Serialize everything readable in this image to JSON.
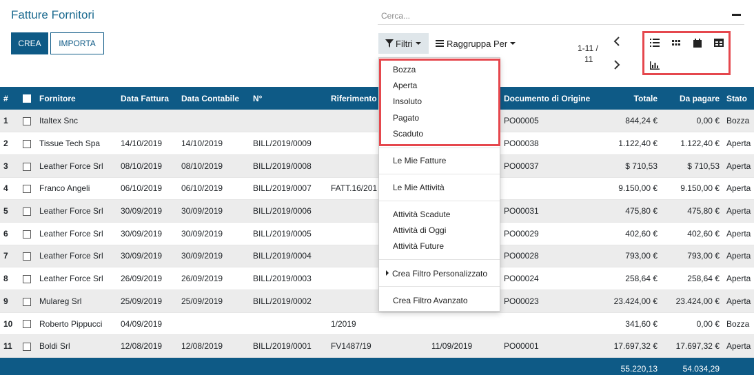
{
  "page_title": "Fatture Fornitori",
  "buttons": {
    "crea": "CREA",
    "importa": "IMPORTA"
  },
  "search": {
    "placeholder": "Cerca...",
    "value": ""
  },
  "toolbar": {
    "filtri": "Filtri",
    "raggruppa": "Raggruppa Per"
  },
  "pager": {
    "range": "1-11 /",
    "total": "11"
  },
  "views": [
    "list-view-icon",
    "kanban-view-icon",
    "calendar-view-icon",
    "pivot-view-icon",
    "graph-view-icon"
  ],
  "filters_menu": {
    "status_filters": [
      "Bozza",
      "Aperta",
      "Insoluto",
      "Pagato",
      "Scaduto"
    ],
    "my_invoices": "Le Mie Fatture",
    "my_activities": "Le Mie Attività",
    "activity_filters": [
      "Attività Scadute",
      "Attività di Oggi",
      "Attività Future"
    ],
    "custom_filter": "Crea Filtro Personalizzato",
    "advanced_filter": "Crea Filtro Avanzato"
  },
  "table": {
    "columns": [
      "#",
      "",
      "Fornitore",
      "Data Fattura",
      "Data Contabile",
      "N°",
      "Riferimento",
      "",
      "Documento di Origine",
      "Totale",
      "Da pagare",
      "Stato"
    ],
    "rows": [
      [
        "1",
        "",
        "Italtex Snc",
        "",
        "",
        "",
        "",
        "",
        "PO00005",
        "844,24 €",
        "0,00 €",
        "Bozza"
      ],
      [
        "2",
        "",
        "Tissue Tech Spa",
        "14/10/2019",
        "14/10/2019",
        "BILL/2019/0009",
        "",
        "",
        "PO00038",
        "1.122,40 €",
        "1.122,40 €",
        "Aperta"
      ],
      [
        "3",
        "",
        "Leather Force Srl",
        "08/10/2019",
        "08/10/2019",
        "BILL/2019/0008",
        "",
        "",
        "PO00037",
        "$ 710,53",
        "$ 710,53",
        "Aperta"
      ],
      [
        "4",
        "",
        "Franco Angeli",
        "06/10/2019",
        "06/10/2019",
        "BILL/2019/0007",
        "FATT.16/201",
        "",
        "",
        "9.150,00 €",
        "9.150,00 €",
        "Aperta"
      ],
      [
        "5",
        "",
        "Leather Force Srl",
        "30/09/2019",
        "30/09/2019",
        "BILL/2019/0006",
        "",
        "",
        "PO00031",
        "475,80 €",
        "475,80 €",
        "Aperta"
      ],
      [
        "6",
        "",
        "Leather Force Srl",
        "30/09/2019",
        "30/09/2019",
        "BILL/2019/0005",
        "",
        "",
        "PO00029",
        "402,60 €",
        "402,60 €",
        "Aperta"
      ],
      [
        "7",
        "",
        "Leather Force Srl",
        "30/09/2019",
        "30/09/2019",
        "BILL/2019/0004",
        "",
        "",
        "PO00028",
        "793,00 €",
        "793,00 €",
        "Aperta"
      ],
      [
        "8",
        "",
        "Leather Force Srl",
        "26/09/2019",
        "26/09/2019",
        "BILL/2019/0003",
        "",
        "",
        "PO00024",
        "258,64 €",
        "258,64 €",
        "Aperta"
      ],
      [
        "9",
        "",
        "Mulareg Srl",
        "25/09/2019",
        "25/09/2019",
        "BILL/2019/0002",
        "",
        "",
        "PO00023",
        "23.424,00 €",
        "23.424,00 €",
        "Aperta"
      ],
      [
        "10",
        "",
        "Roberto Pippucci",
        "04/09/2019",
        "",
        "",
        "1/2019",
        "",
        "",
        "341,60 €",
        "0,00 €",
        "Bozza"
      ],
      [
        "11",
        "",
        "Boldi Srl",
        "12/08/2019",
        "12/08/2019",
        "BILL/2019/0001",
        "FV1487/19",
        "11/09/2019",
        "PO00001",
        "17.697,32 €",
        "17.697,32 €",
        "Aperta"
      ]
    ],
    "footer": {
      "totale": "55.220,13",
      "da_pagare": "54.034,29"
    }
  },
  "colors": {
    "primary": "#0e5a86",
    "title": "#1b6a8f",
    "highlight": "#e5474d",
    "filter_active_bg": "#dfe6ea"
  }
}
